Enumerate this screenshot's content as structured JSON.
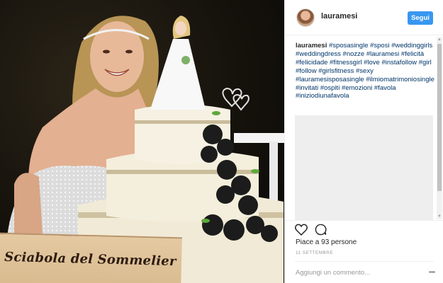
{
  "post": {
    "username": "lauramesi",
    "follow_label": "Segui",
    "caption_user": "lauramesi",
    "caption_tags": "#sposasingle #sposi #weddinggirls #weddingdress #nozze #lauramesi #felicità #felicidade #fitnessgirl #love #instafollow #girl #follow #girlsfitness #sexy #lauramesisposasingle #ilmiomatrimoniosingle #invitati #ospiti #emozioni #favola #iniziodiunafavola",
    "likes_text": "Piace a 93 persone",
    "date_text": "11 SETTEMBRE",
    "comment_placeholder": "Aggiungi un commento...",
    "more_label": "•••"
  },
  "photo": {
    "sign_text": "Sciabola del Sommelier"
  },
  "icons": {
    "like": "heart-icon",
    "comment": "comment-icon",
    "scroll_up": "▲",
    "scroll_down": "▼"
  },
  "colors": {
    "accent": "#3897f0",
    "hashtag": "#003569",
    "text": "#262626",
    "muted": "#999999"
  }
}
